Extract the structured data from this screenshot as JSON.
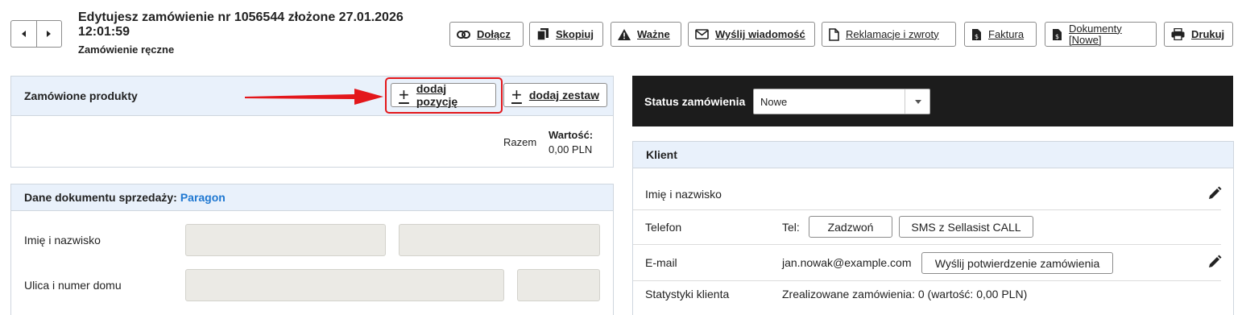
{
  "header": {
    "title": "Edytujesz zamówienie nr 1056544 złożone 27.01.2026 12:01:59",
    "subtitle": "Zamówienie ręczne"
  },
  "toolbar": {
    "attach": "Dołącz",
    "copy": "Skopiuj",
    "important": "Ważne",
    "send_message": "Wyślij wiadomość",
    "complaints": "Reklamacje i zwroty",
    "invoice": "Faktura",
    "documents": "Dokumenty [Nowe]",
    "print": "Drukuj"
  },
  "products": {
    "title": "Zamówione produkty",
    "add_item": "dodaj pozycję",
    "add_set": "dodaj zestaw",
    "total_label": "Razem",
    "value_label": "Wartość:",
    "value": "0,00 PLN"
  },
  "sales_doc": {
    "title": "Dane dokumentu sprzedaży:",
    "type": "Paragon",
    "name_label": "Imię i nazwisko",
    "street_label": "Ulica i numer domu"
  },
  "status": {
    "label": "Status zamówienia",
    "value": "Nowe"
  },
  "client": {
    "title": "Klient",
    "name_label": "Imię i nazwisko",
    "phone_label": "Telefon",
    "tel_prefix": "Tel:",
    "call_button": "Zadzwoń",
    "sms_button": "SMS z Sellasist CALL",
    "email_label": "E-mail",
    "email": "jan.nowak@example.com",
    "confirm_button": "Wyślij potwierdzenie zamówienia",
    "stats_label": "Statystyki klienta",
    "stats_value": "Zrealizowane zamówienia: 0 (wartość: 0,00 PLN)"
  },
  "colors": {
    "accent_blue": "#1f78d1",
    "highlight_red": "#e3171b",
    "status_bar": "#1c1c1c",
    "panel_header": "#e9f1fb"
  }
}
